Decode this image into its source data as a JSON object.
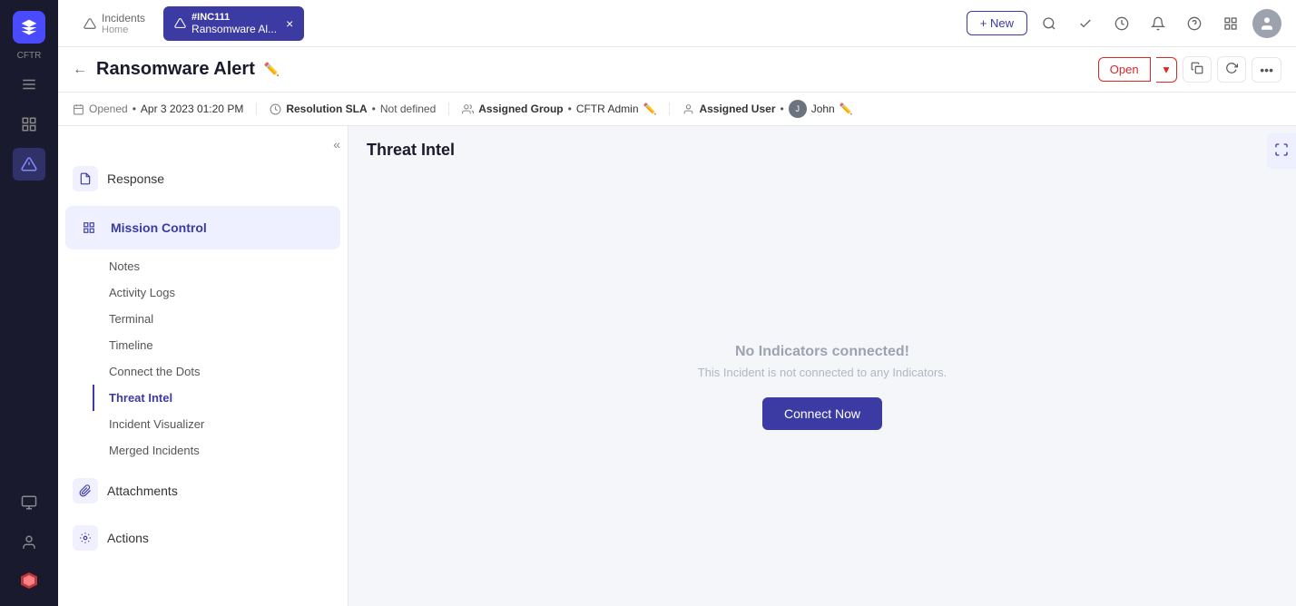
{
  "app": {
    "name": "CFTR",
    "logo_text": "CFTR"
  },
  "topbar": {
    "new_button": "+ New",
    "tab_home_label": "Incidents",
    "tab_home_sub": "Home",
    "tab_active_id": "#INC111",
    "tab_active_label": "Ransomware Al...",
    "tab_close": "×"
  },
  "page": {
    "title": "Ransomware Alert",
    "back_label": "←",
    "edit_icon": "✏️",
    "status_open": "Open",
    "status_dropdown": "▾"
  },
  "meta": {
    "opened_label": "Opened",
    "opened_value": "Apr 3 2023 01:20 PM",
    "resolution_label": "Resolution SLA",
    "resolution_value": "Not defined",
    "group_label": "Assigned Group",
    "group_value": "CFTR Admin",
    "user_label": "Assigned User",
    "user_value": "John"
  },
  "left_panel": {
    "collapse_icon": "«",
    "sections": [
      {
        "id": "response",
        "icon": "📋",
        "label": "Response"
      },
      {
        "id": "mission-control",
        "icon": "🗒",
        "label": "Mission Control",
        "active": true
      },
      {
        "id": "attachments",
        "icon": "📎",
        "label": "Attachments"
      },
      {
        "id": "actions",
        "icon": "⚙",
        "label": "Actions"
      }
    ],
    "sub_items": [
      {
        "id": "notes",
        "label": "Notes",
        "active": false
      },
      {
        "id": "activity-logs",
        "label": "Activity Logs",
        "active": false
      },
      {
        "id": "terminal",
        "label": "Terminal",
        "active": false
      },
      {
        "id": "timeline",
        "label": "Timeline",
        "active": false
      },
      {
        "id": "connect-the-dots",
        "label": "Connect the Dots",
        "active": false
      },
      {
        "id": "threat-intel",
        "label": "Threat Intel",
        "active": true
      },
      {
        "id": "incident-visualizer",
        "label": "Incident Visualizer",
        "active": false
      },
      {
        "id": "merged-incidents",
        "label": "Merged Incidents",
        "active": false
      }
    ]
  },
  "threat_intel": {
    "title": "Threat Intel",
    "empty_title": "No Indicators connected!",
    "empty_subtitle": "This Incident is not connected to any Indicators.",
    "connect_button": "Connect Now"
  }
}
